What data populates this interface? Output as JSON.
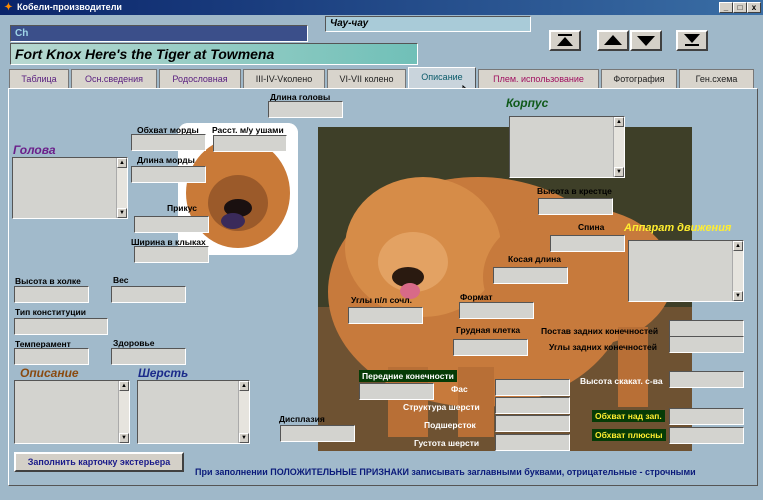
{
  "window": {
    "title": "Кобели-производители",
    "controls": [
      "_",
      "□",
      "x"
    ]
  },
  "header": {
    "code": "Ch",
    "breed": "Чау-чау",
    "dog_name": "Fort Knox Here's the Tiger at Towmena"
  },
  "nav_buttons": [
    "first",
    "prev",
    "next",
    "last"
  ],
  "tabs": [
    "Таблица",
    "Осн.сведения",
    "Родословная",
    "III-IV-Vколено",
    "VI-VII колено",
    "Описание",
    "Плем. использование",
    "Фотография",
    "Ген.схема"
  ],
  "active_tab": "Описание",
  "sections": {
    "golova": "Голова",
    "korpus": "Корпус",
    "apparat": "Аппарат движения",
    "opisanie": "Описание",
    "sherst": "Шерсть"
  },
  "labels": {
    "dlina_golovy": "Длина головы",
    "obhvat_mordy": "Обхват морды",
    "rasst_ushami": "Расст. м/у ушами",
    "dlina_mordy": "Длина морды",
    "prikus": "Прикус",
    "shirina_klykah": "Ширина в клыках",
    "vysota_holke": "Высота в холке",
    "ves": "Вес",
    "tip_konstitucii": "Тип конституции",
    "temperament": "Темперамент",
    "zdorovie": "Здоровье",
    "vysota_kreste": "Высота в крестце",
    "spina": "Спина",
    "kosaya_dlina": "Косая длина",
    "format": "Формат",
    "ugly_sochl": "Углы п/л сочл.",
    "grudnaya_kletka": "Грудная клетка",
    "postav_zadnih": "Постав задних конечностей",
    "ugly_zadnih": "Углы задних конечностей",
    "perednie_konechnosti": "Передние конечности",
    "anfas": "Фас",
    "struktura_shersti": "Структура шерсти",
    "podsherstok": "Подшерсток",
    "gustota_shersti": "Густота шерсти",
    "vysota_skakat": "Высота скакат. с-ва",
    "obhvat_nad_zap": "Обхват над зап.",
    "obhvat_plyusny": "Обхват плюсны",
    "displaziya": "Дисплазия"
  },
  "fill_button": "Заполнить карточку экстерьера",
  "hint": "При заполнении ПОЛОЖИТЕЛЬНЫЕ ПРИЗНАКИ записывать заглавными буквами, отрицательные - строчными",
  "colors": {
    "titlebar": "#0a246a",
    "golova": "#6b1f8a",
    "korpus": "#0f5a1a",
    "apparat": "#ffee30",
    "opisanie": "#8a4a10",
    "sherst": "#1a2a8a",
    "hint": "#0a1a7a"
  }
}
